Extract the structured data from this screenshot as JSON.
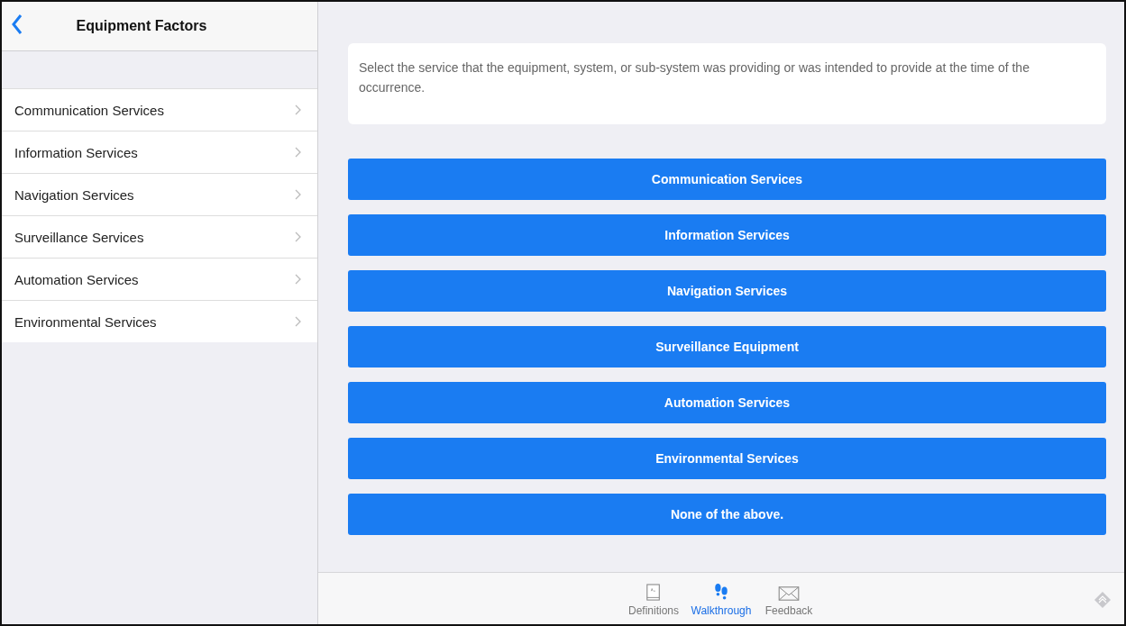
{
  "sidebar": {
    "title": "Equipment Factors",
    "items": [
      {
        "label": "Communication Services"
      },
      {
        "label": "Information Services"
      },
      {
        "label": "Navigation Services"
      },
      {
        "label": "Surveillance Services"
      },
      {
        "label": "Automation Services"
      },
      {
        "label": "Environmental Services"
      }
    ]
  },
  "prompt": "Select the service that the equipment, system, or sub-system was providing or was intended to provide at the time of the occurrence.",
  "options": [
    "Communication Services",
    "Information Services",
    "Navigation Services",
    "Surveillance Equipment",
    "Automation Services",
    "Environmental Services",
    "None of the above."
  ],
  "tabs": [
    {
      "kind": "book",
      "label": "Definitions",
      "selected": false
    },
    {
      "kind": "steps",
      "label": "Walkthrough",
      "selected": true
    },
    {
      "kind": "mail",
      "label": "Feedback",
      "selected": false
    }
  ]
}
